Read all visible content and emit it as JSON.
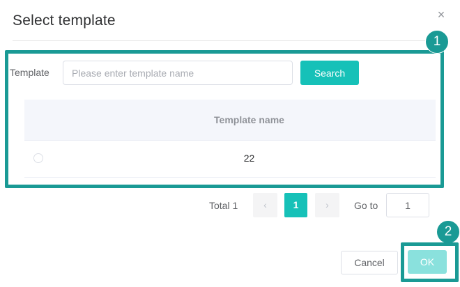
{
  "dialog": {
    "title": "Select template",
    "close_glyph": "×"
  },
  "filter": {
    "label": "Template",
    "placeholder": "Please enter template name",
    "value": "",
    "search_label": "Search"
  },
  "table": {
    "columns": [
      "Template name"
    ],
    "rows": [
      {
        "selected": false,
        "name": "22"
      }
    ]
  },
  "pagination": {
    "total_text": "Total 1",
    "prev_glyph": "‹",
    "next_glyph": "›",
    "current_page": "1",
    "goto_label": "Go to",
    "goto_value": "1"
  },
  "footer": {
    "cancel_label": "Cancel",
    "ok_label": "OK"
  },
  "annotations": {
    "badge_1": "1",
    "badge_2": "2"
  },
  "colors": {
    "primary": "#16c1b8",
    "primary_disabled": "#8ae1dd",
    "annotation": "#1a9a95",
    "header_bg": "#f4f6fb"
  }
}
